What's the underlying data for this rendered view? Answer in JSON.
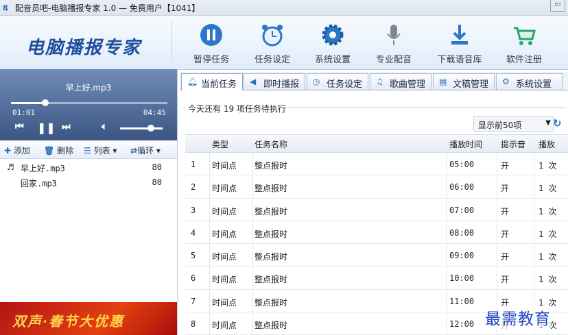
{
  "window": {
    "title": "配音员吧-电脑播报专家 1.0 — 免费用户【1041】",
    "logo_text": "电脑播报专家"
  },
  "toolbar": [
    {
      "label": "暂停任务",
      "icon": "pause-icon"
    },
    {
      "label": "任务设定",
      "icon": "alarm-clock-icon"
    },
    {
      "label": "系统设置",
      "icon": "gear-icon"
    },
    {
      "label": "专业配音",
      "icon": "microphone-icon"
    },
    {
      "label": "下载语音库",
      "icon": "download-icon"
    },
    {
      "label": "软件注册",
      "icon": "cart-icon"
    }
  ],
  "player": {
    "song": "早上好.mp3",
    "current_time": "01:01",
    "total_time": "04:45",
    "progress": 0.22,
    "volume": 0.72
  },
  "list_toolbar": {
    "add": "添加",
    "delete": "删除",
    "list": "列表",
    "loop": "循环"
  },
  "playlist": [
    {
      "name": "早上好.mp3",
      "value": "80",
      "playing": true
    },
    {
      "name": "回家.mp3",
      "value": "80",
      "playing": false
    }
  ],
  "banner": {
    "text": "双声·春节大优惠"
  },
  "tabs": [
    {
      "label": "当前任务",
      "icon": "bell-icon",
      "active": true
    },
    {
      "label": "即时播报",
      "icon": "play-icon",
      "active": false
    },
    {
      "label": "任务设定",
      "icon": "clock-icon",
      "active": false
    },
    {
      "label": "歌曲管理",
      "icon": "music-icon",
      "active": false
    },
    {
      "label": "文稿管理",
      "icon": "document-icon",
      "active": false
    },
    {
      "label": "系统设置",
      "icon": "gear-icon",
      "active": false
    }
  ],
  "task_panel": {
    "legend": "今天还有 19 项任务待执行",
    "filter": "显示前50项",
    "columns": [
      "类型",
      "任务名称",
      "播放时间",
      "提示音",
      "播放"
    ],
    "rows": [
      {
        "no": "1",
        "type": "时间点",
        "name": "整点报时",
        "time": "05:00",
        "tone": "开",
        "play": "1 次"
      },
      {
        "no": "2",
        "type": "时间点",
        "name": "整点报时",
        "time": "06:00",
        "tone": "开",
        "play": "1 次"
      },
      {
        "no": "3",
        "type": "时间点",
        "name": "整点报时",
        "time": "07:00",
        "tone": "开",
        "play": "1 次"
      },
      {
        "no": "4",
        "type": "时间点",
        "name": "整点报时",
        "time": "08:00",
        "tone": "开",
        "play": "1 次"
      },
      {
        "no": "5",
        "type": "时间点",
        "name": "整点报时",
        "time": "09:00",
        "tone": "开",
        "play": "1 次"
      },
      {
        "no": "6",
        "type": "时间点",
        "name": "整点报时",
        "time": "10:00",
        "tone": "开",
        "play": "1 次"
      },
      {
        "no": "7",
        "type": "时间点",
        "name": "整点报时",
        "time": "11:00",
        "tone": "开",
        "play": "1 次"
      },
      {
        "no": "8",
        "type": "时间点",
        "name": "整点报时",
        "time": "12:00",
        "tone": "开",
        "play": "1 次"
      }
    ]
  },
  "watermark": "最需教育",
  "colors": {
    "accent": "#2f6fbf",
    "player_bg": "#3b5683",
    "banner": "#c81e12"
  }
}
